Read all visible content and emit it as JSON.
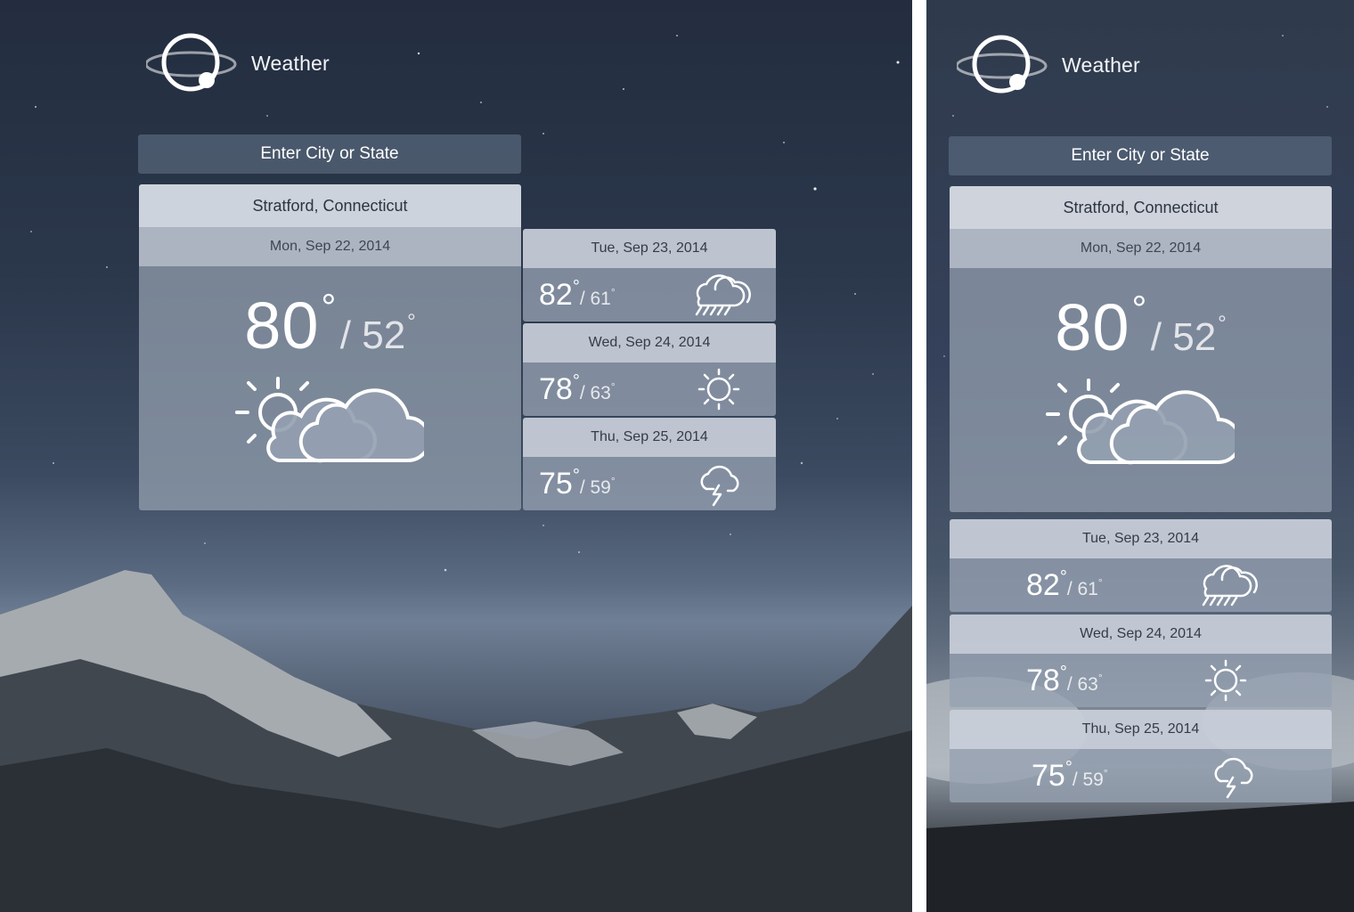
{
  "app": {
    "name": "Weather",
    "logo_icon": "orbit-logo-icon"
  },
  "search": {
    "placeholder": "Enter City or State"
  },
  "location": "Stratford, Connecticut",
  "today": {
    "date": "Mon,  Sep 22, 2014",
    "high": "80",
    "low": "/ 52",
    "deg": "°",
    "icon": "partly-cloudy-icon"
  },
  "forecast": [
    {
      "date": "Tue,  Sep 23, 2014",
      "high": "82",
      "low": "/ 61",
      "icon": "rain-cloud-icon"
    },
    {
      "date": "Wed,  Sep 24, 2014",
      "high": "78",
      "low": "/ 63",
      "icon": "sun-icon"
    },
    {
      "date": "Thu,  Sep 25, 2014",
      "high": "75",
      "low": "/ 59",
      "icon": "thunder-cloud-icon"
    }
  ],
  "colors": {
    "accent_text": "#ffffff",
    "header_bg": "#d4dae2",
    "body_bg": "#94a0b0"
  }
}
